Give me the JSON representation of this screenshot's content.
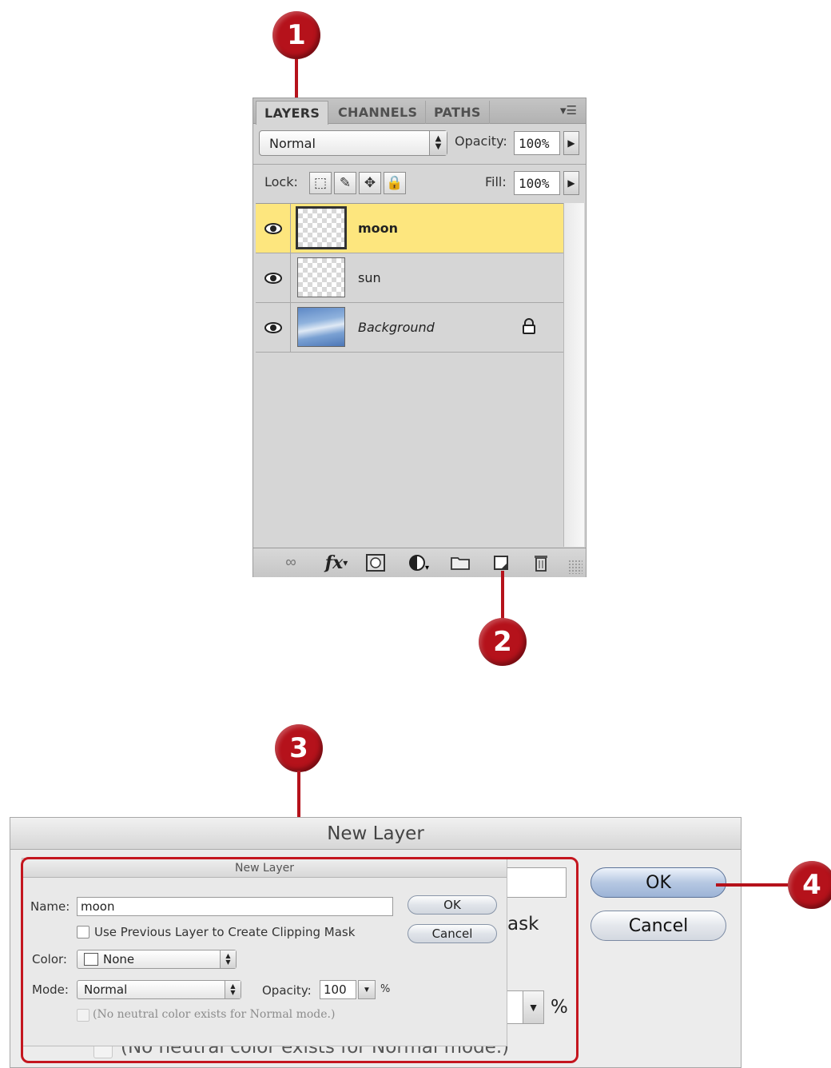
{
  "callouts": {
    "c1": "1",
    "c2": "2",
    "c3": "3",
    "c4": "4"
  },
  "layers_panel": {
    "tabs": [
      {
        "label": "LAYERS"
      },
      {
        "label": "CHANNELS"
      },
      {
        "label": "PATHS"
      }
    ],
    "panel_menu_icon": "panel-menu-icon",
    "blend_mode": "Normal",
    "opacity_label": "Opacity:",
    "opacity_value": "100%",
    "lock_label": "Lock:",
    "fill_label": "Fill:",
    "fill_value": "100%",
    "layers": [
      {
        "name": "moon",
        "selected": true,
        "visible": true
      },
      {
        "name": "sun",
        "selected": false,
        "visible": true
      },
      {
        "name": "Background",
        "selected": false,
        "visible": true,
        "locked": true
      }
    ],
    "bottom_icons": [
      "link-icon",
      "fx-icon",
      "mask-icon",
      "adjustment-icon",
      "group-folder-icon",
      "new-layer-icon",
      "trash-icon"
    ],
    "fx_label": "fx"
  },
  "dialog": {
    "title": "New Layer",
    "ok_label": "OK",
    "cancel_label": "Cancel",
    "fragment_ask": "ask",
    "fragment_percent": "%",
    "big_note": "(No neutral color exists for Normal mode.)",
    "inner": {
      "title": "New Layer",
      "name_label": "Name:",
      "name_value": "moon",
      "clip_label": "Use Previous Layer to Create Clipping Mask",
      "color_label": "Color:",
      "color_value": "None",
      "mode_label": "Mode:",
      "mode_value": "Normal",
      "opacity_label": "Opacity:",
      "opacity_value": "100",
      "percent": "%",
      "note": "(No neutral color exists for Normal mode.)",
      "ok_label": "OK",
      "cancel_label": "Cancel"
    }
  },
  "colors": {
    "callout_red": "#b5121b",
    "selected_layer": "#fde67e"
  }
}
